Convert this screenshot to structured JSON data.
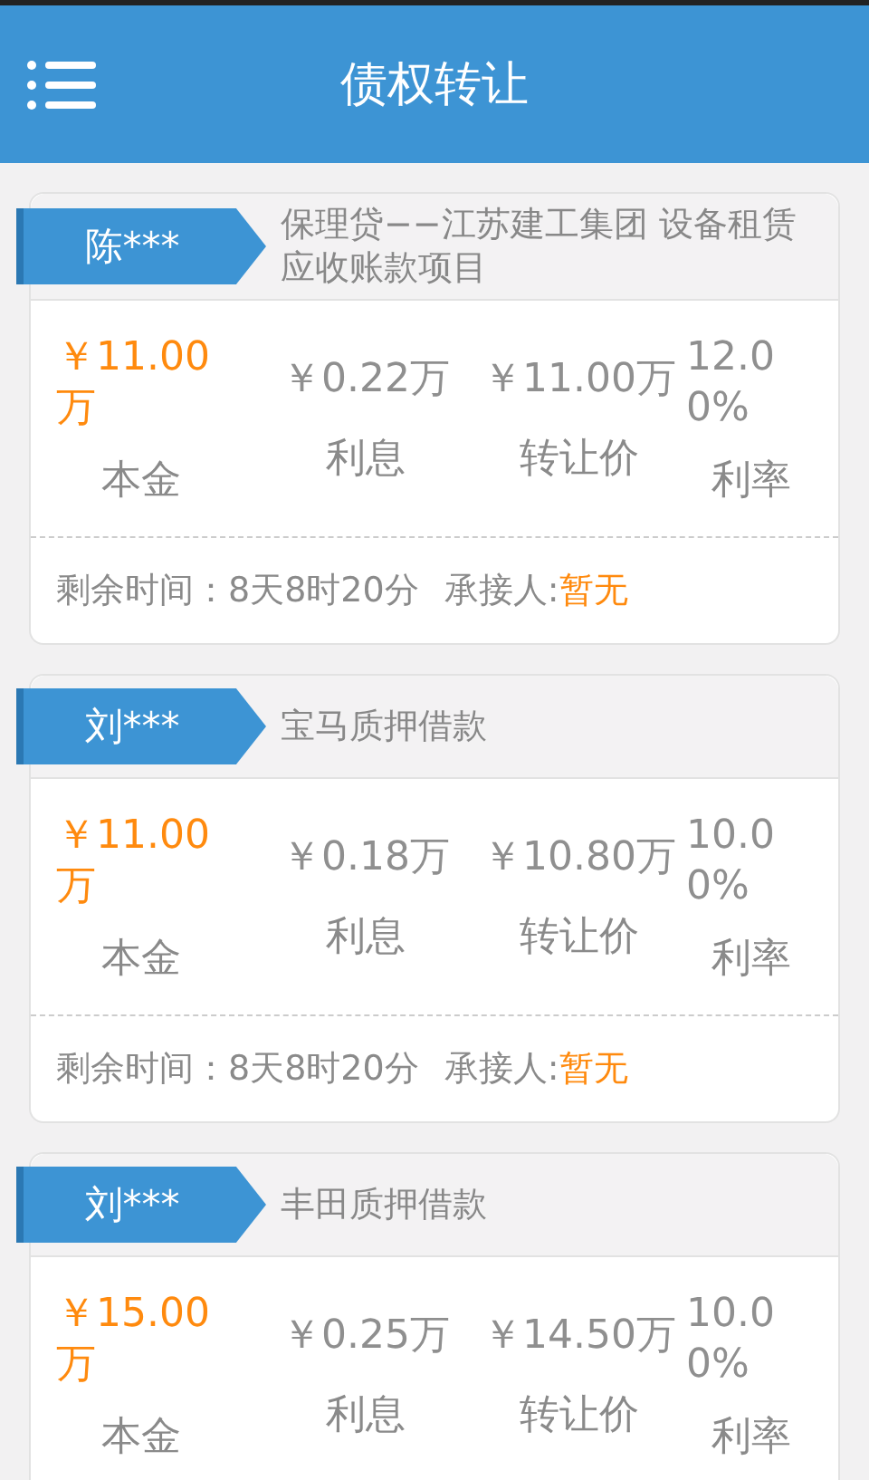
{
  "header": {
    "title": "债权转让"
  },
  "cards": [
    {
      "name": "陈***",
      "title": "保理贷−−江苏建工集团 设备租赁应收账款项目",
      "stats": [
        {
          "kind": "principal",
          "value": "￥11.00万",
          "label": "本金"
        },
        {
          "kind": "amount",
          "value": "￥0.22万",
          "label": "利息"
        },
        {
          "kind": "amount",
          "value": "￥11.00万",
          "label": "转让价"
        },
        {
          "kind": "rate",
          "value": "12.00%",
          "label": "利率"
        }
      ],
      "footer": {
        "remaining": "剩余时间：8天8时20分",
        "taker_label": "承接人:",
        "taker": "暂无"
      }
    },
    {
      "name": "刘***",
      "title": "宝马质押借款",
      "stats": [
        {
          "kind": "principal",
          "value": "￥11.00万",
          "label": "本金"
        },
        {
          "kind": "amount",
          "value": "￥0.18万",
          "label": "利息"
        },
        {
          "kind": "amount",
          "value": "￥10.80万",
          "label": "转让价"
        },
        {
          "kind": "rate",
          "value": "10.00%",
          "label": "利率"
        }
      ],
      "footer": {
        "remaining": "剩余时间：8天8时20分",
        "taker_label": "承接人:",
        "taker": "暂无"
      }
    },
    {
      "name": "刘***",
      "title": "丰田质押借款",
      "stats": [
        {
          "kind": "principal",
          "value": "￥15.00万",
          "label": "本金"
        },
        {
          "kind": "amount",
          "value": "￥0.25万",
          "label": "利息"
        },
        {
          "kind": "amount",
          "value": "￥14.50万",
          "label": "转让价"
        },
        {
          "kind": "rate",
          "value": "10.00%",
          "label": "利率"
        }
      ]
    }
  ]
}
